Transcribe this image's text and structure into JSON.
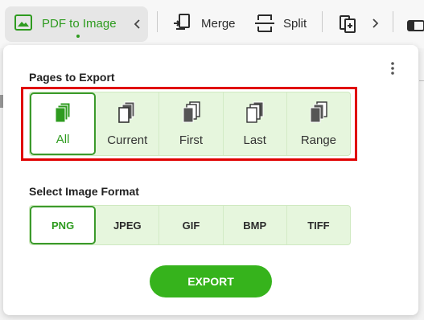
{
  "toolbar": {
    "active_tab": "PDF to Image",
    "tools": [
      {
        "label": "Merge",
        "icon": "merge-icon"
      },
      {
        "label": "Split",
        "icon": "split-icon"
      }
    ]
  },
  "pages_section": {
    "title": "Pages to Export",
    "options": [
      {
        "label": "All",
        "icon": "pages-all-icon",
        "selected": true
      },
      {
        "label": "Current",
        "icon": "page-current-icon"
      },
      {
        "label": "First",
        "icon": "page-first-icon"
      },
      {
        "label": "Last",
        "icon": "page-last-icon"
      },
      {
        "label": "Range",
        "icon": "page-range-icon"
      }
    ]
  },
  "format_section": {
    "title": "Select Image Format",
    "options": [
      {
        "label": "PNG",
        "selected": true
      },
      {
        "label": "JPEG"
      },
      {
        "label": "GIF"
      },
      {
        "label": "BMP"
      },
      {
        "label": "TIFF"
      }
    ]
  },
  "export_label": "EXPORT",
  "colors": {
    "accent": "#2e9b1f",
    "segment_bg": "#e6f6dd",
    "button": "#36b31c",
    "highlight": "#e00000"
  }
}
